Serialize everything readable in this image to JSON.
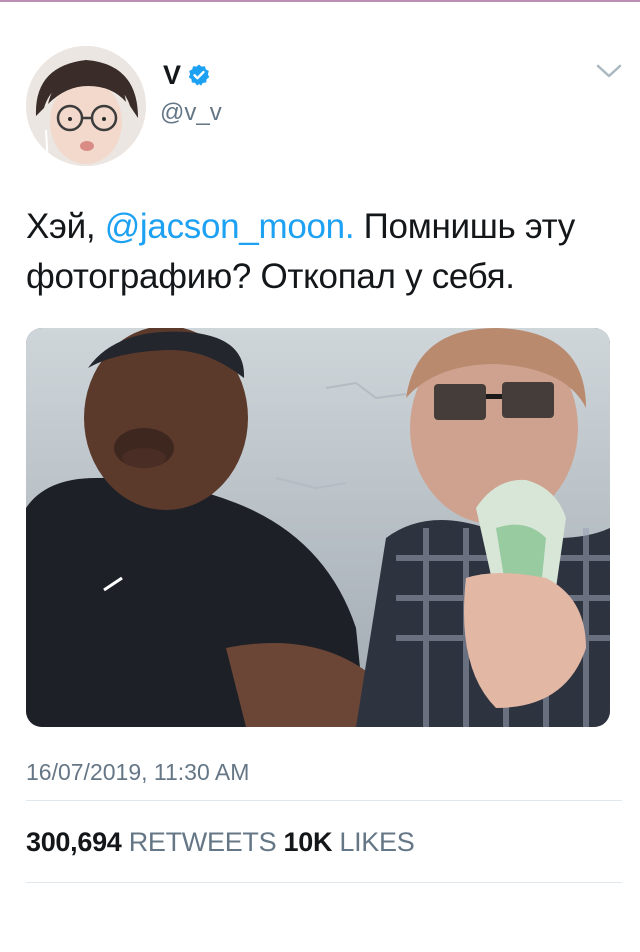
{
  "user": {
    "display_name": "V",
    "handle": "@v_v",
    "verified": true,
    "avatar_icon": "avatar-photo"
  },
  "tweet": {
    "text_prefix": "Хэй, ",
    "mention": "@jacson_moon.",
    "text_suffix": " Помнишь эту фотографию? Откопал у себя.",
    "timestamp": "16/07/2019, 11:30 AM"
  },
  "stats": {
    "retweets_count": "300,694",
    "retweets_label": "RETWEETS",
    "likes_count": "10K",
    "likes_label": "LIKES"
  },
  "colors": {
    "mention": "#1da1f2",
    "verified_badge": "#1da1f2",
    "secondary_text": "#657786",
    "divider": "#e1e8ed"
  },
  "icons": {
    "verified": "verified-badge-icon",
    "more": "chevron-down-icon"
  }
}
